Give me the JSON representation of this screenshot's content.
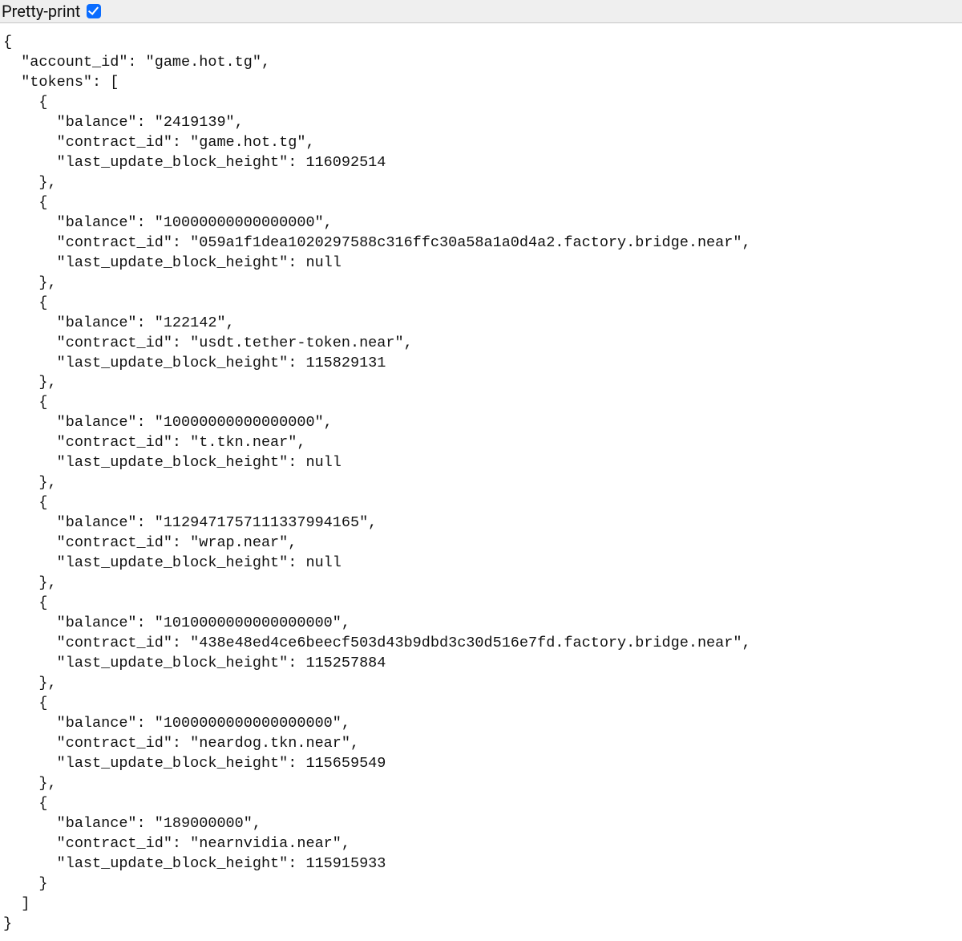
{
  "toolbar": {
    "pretty_print_label": "Pretty-print",
    "pretty_print_checked": true
  },
  "json_payload": {
    "account_id": "game.hot.tg",
    "tokens": [
      {
        "balance": "2419139",
        "contract_id": "game.hot.tg",
        "last_update_block_height": 116092514
      },
      {
        "balance": "10000000000000000",
        "contract_id": "059a1f1dea1020297588c316ffc30a58a1a0d4a2.factory.bridge.near",
        "last_update_block_height": null
      },
      {
        "balance": "122142",
        "contract_id": "usdt.tether-token.near",
        "last_update_block_height": 115829131
      },
      {
        "balance": "10000000000000000",
        "contract_id": "t.tkn.near",
        "last_update_block_height": null
      },
      {
        "balance": "1129471757111337994165",
        "contract_id": "wrap.near",
        "last_update_block_height": null
      },
      {
        "balance": "1010000000000000000",
        "contract_id": "438e48ed4ce6beecf503d43b9dbd3c30d516e7fd.factory.bridge.near",
        "last_update_block_height": 115257884
      },
      {
        "balance": "1000000000000000000",
        "contract_id": "neardog.tkn.near",
        "last_update_block_height": 115659549
      },
      {
        "balance": "189000000",
        "contract_id": "nearnvidia.near",
        "last_update_block_height": 115915933
      }
    ]
  }
}
